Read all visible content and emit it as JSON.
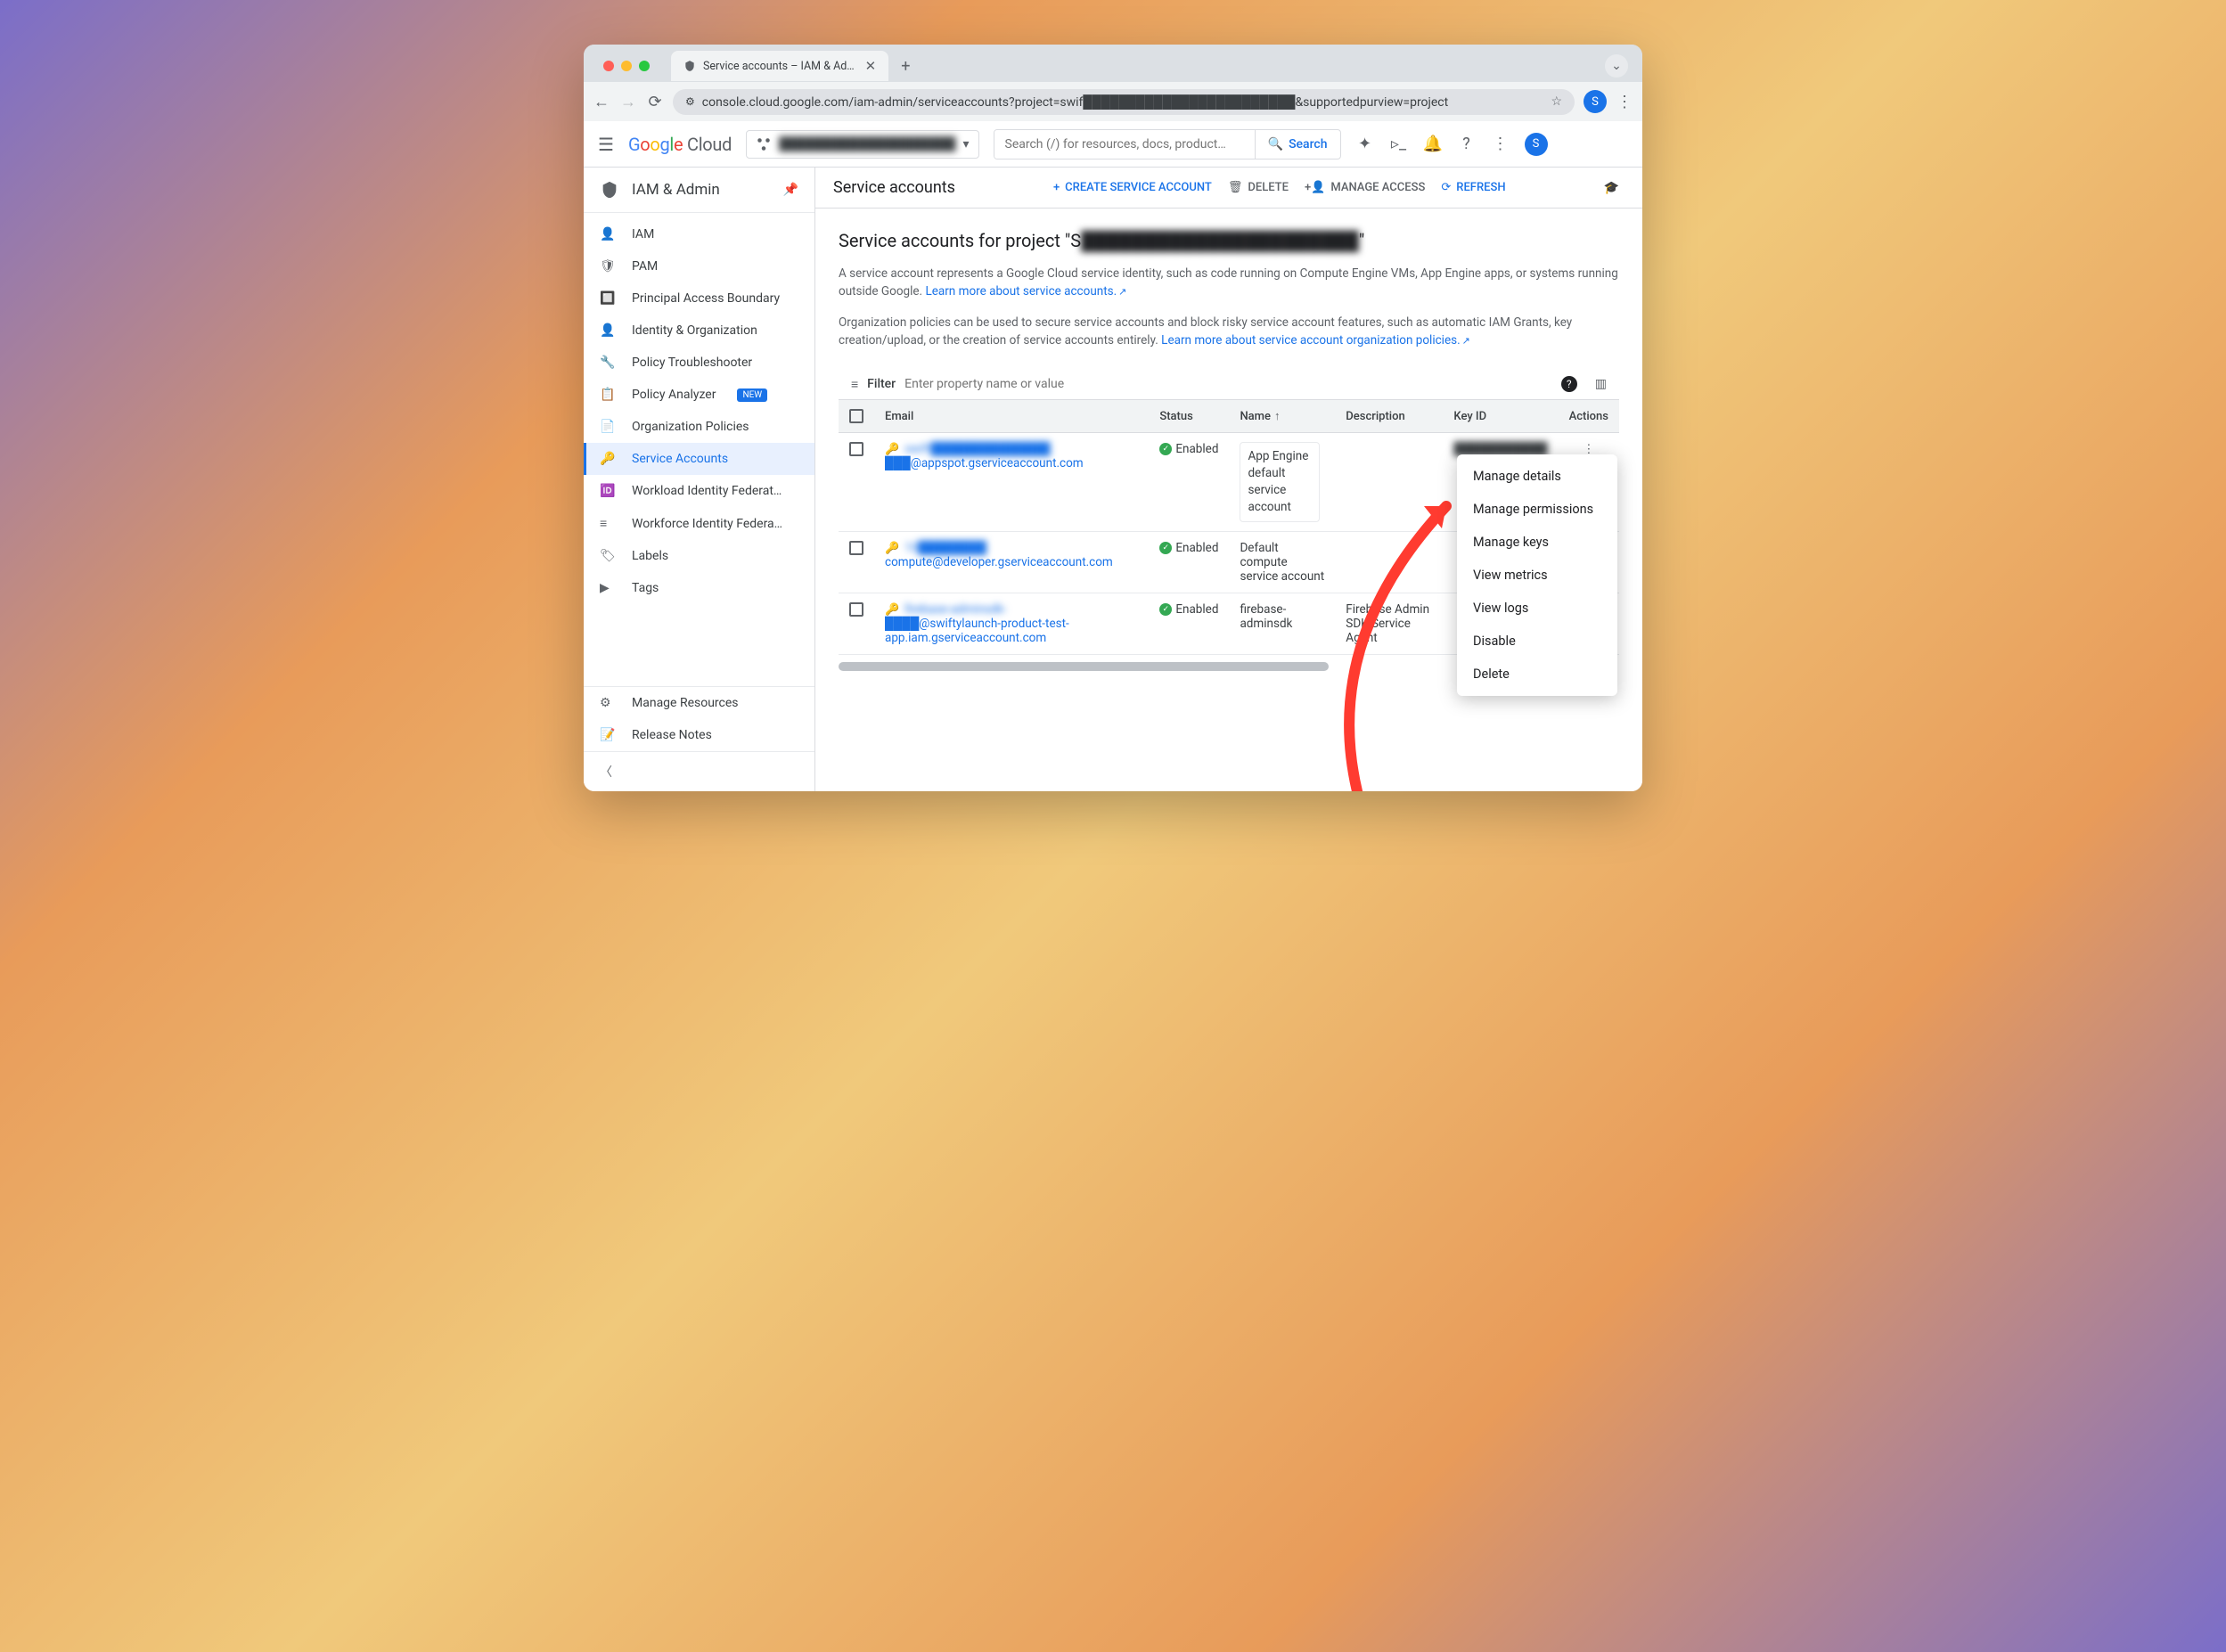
{
  "tab": {
    "title": "Service accounts – IAM & Ad…"
  },
  "url": "console.cloud.google.com/iam-admin/serviceaccounts?project=swif████████████████████████&supportedpurview=project",
  "logo": {
    "g": "Google",
    "c": " Cloud"
  },
  "project": {
    "name": "████████████████████"
  },
  "search": {
    "placeholder": "Search (/) for resources, docs, product…",
    "button": "Search"
  },
  "avatar": "S",
  "sidebar": {
    "title": "IAM & Admin",
    "items": [
      {
        "icon": "👤",
        "label": "IAM"
      },
      {
        "icon": "🛡",
        "label": "PAM"
      },
      {
        "icon": "🔲",
        "label": "Principal Access Boundary"
      },
      {
        "icon": "👤",
        "label": "Identity & Organization"
      },
      {
        "icon": "🔧",
        "label": "Policy Troubleshooter"
      },
      {
        "icon": "📋",
        "label": "Policy Analyzer",
        "new": true
      },
      {
        "icon": "📄",
        "label": "Organization Policies"
      },
      {
        "icon": "🔑",
        "label": "Service Accounts",
        "active": true
      },
      {
        "icon": "🆔",
        "label": "Workload Identity Federat…"
      },
      {
        "icon": "≡",
        "label": "Workforce Identity Federa…"
      },
      {
        "icon": "🏷",
        "label": "Labels"
      },
      {
        "icon": "▶",
        "label": "Tags"
      }
    ],
    "bottom": [
      {
        "icon": "⚙",
        "label": "Manage Resources"
      },
      {
        "icon": "📝",
        "label": "Release Notes"
      }
    ]
  },
  "toolbar": {
    "title": "Service accounts",
    "create": "CREATE SERVICE ACCOUNT",
    "delete": "DELETE",
    "manage": "MANAGE ACCESS",
    "refresh": "REFRESH"
  },
  "page": {
    "heading_prefix": "Service accounts for project \"S",
    "heading_blur": "██████████████████████",
    "heading_suffix": "\"",
    "desc1": "A service account represents a Google Cloud service identity, such as code running on Compute Engine VMs, App Engine apps, or systems running outside Google. ",
    "link1": "Learn more about service accounts.",
    "desc2": "Organization policies can be used to secure service accounts and block risky service account features, such as automatic IAM Grants, key creation/upload, or the creation of service accounts entirely. ",
    "link2": "Learn more about service account organization policies."
  },
  "filter": {
    "label": "Filter",
    "placeholder": "Enter property name or value"
  },
  "columns": {
    "email": "Email",
    "status": "Status",
    "name": "Name",
    "description": "Description",
    "keyid": "Key ID",
    "actions": "Actions"
  },
  "rows": [
    {
      "email_blur": "swift██████████████",
      "email2": "███@appspot.gserviceaccount.com",
      "status": "Enabled",
      "name": "App Engine default service account",
      "desc": "",
      "keyid": "███████████"
    },
    {
      "email_blur": "10████████",
      "email2": "compute@developer.gserviceaccount.com",
      "status": "Enabled",
      "name": "Default compute service account",
      "desc": "",
      "keyid": ""
    },
    {
      "email_blur": "firebase-adminsdk-",
      "email2": "████@swiftylaunch-product-test-app.iam.gserviceaccount.com",
      "status": "Enabled",
      "name": "firebase-adminsdk",
      "desc": "Firebase Admin SDK Service Agent",
      "keyid": ""
    }
  ],
  "menu": [
    "Manage details",
    "Manage permissions",
    "Manage keys",
    "View metrics",
    "View logs",
    "Disable",
    "Delete"
  ],
  "new_label": "NEW"
}
